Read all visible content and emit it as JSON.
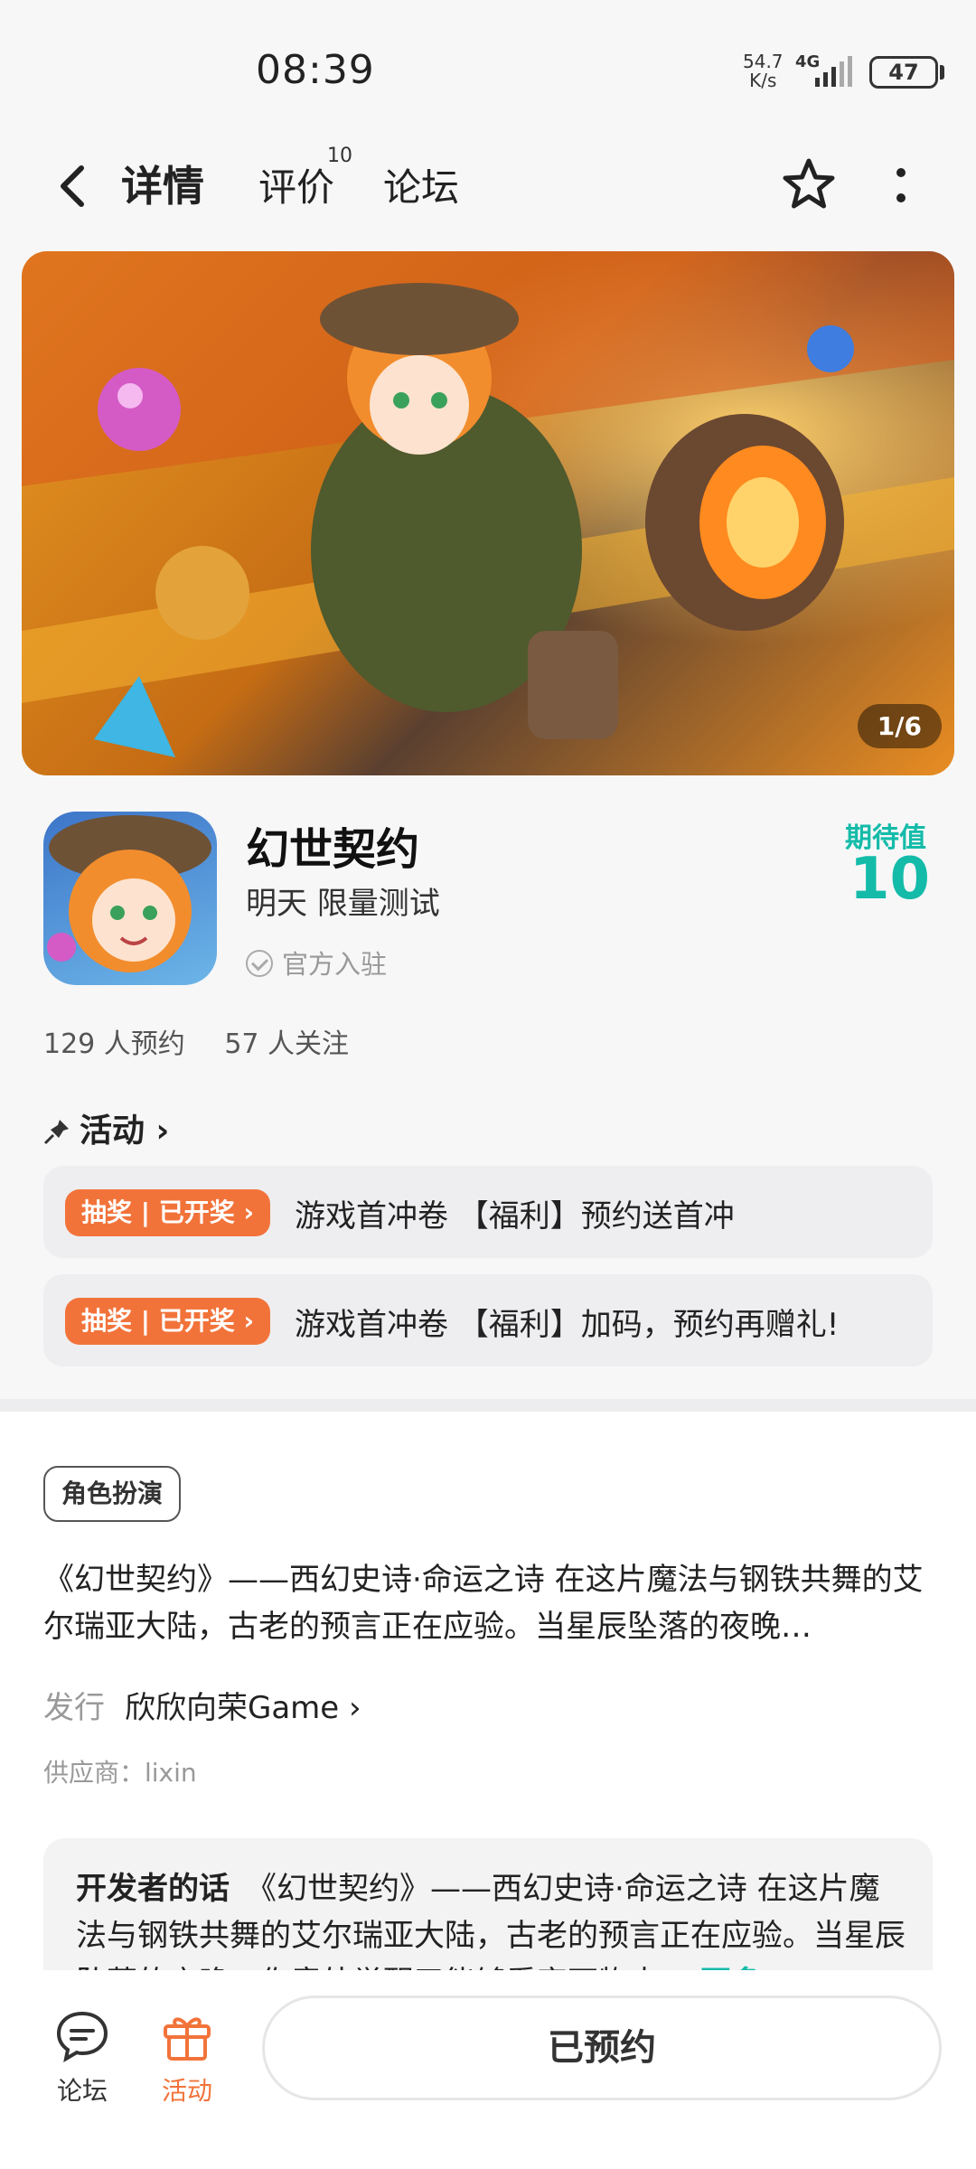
{
  "status_bar": {
    "time": "08:39",
    "net_speed_value": "54.7",
    "net_speed_unit": "K/s",
    "network": "4G",
    "battery": "47"
  },
  "header": {
    "tabs": [
      {
        "label": "详情",
        "active": true
      },
      {
        "label": "评价",
        "count": "10"
      },
      {
        "label": "论坛"
      }
    ]
  },
  "banner": {
    "counter": "1/6"
  },
  "game": {
    "title": "幻世契约",
    "subtitle": "明天 限量测试",
    "official": "官方入驻",
    "expect_label": "期待值",
    "expect_value": "10"
  },
  "stats": {
    "reservations": "129 人预约",
    "followers": "57 人关注"
  },
  "activities": {
    "heading": "活动",
    "items": [
      {
        "badge": "抽奖 | 已开奖 ›",
        "text": "游戏首冲卷 【福利】预约送首冲"
      },
      {
        "badge": "抽奖 | 已开奖 ›",
        "text": "游戏首冲卷 【福利】加码，预约再赠礼!"
      }
    ]
  },
  "details": {
    "tag": "角色扮演",
    "description": "《幻世契约》——西幻史诗·命运之诗 在这片魔法与钢铁共舞的艾尔瑞亚大陆，古老的预言正在应验。当星辰坠落的夜晚…",
    "publisher_label": "发行",
    "publisher_name": "欣欣向荣Game ›",
    "supplier": "供应商：lixin"
  },
  "developer_note": {
    "label": "开发者的话",
    "text": "《幻世契约》——西幻史诗·命运之诗 在这片魔法与钢铁共舞的艾尔瑞亚大陆，古老的预言正在应验。当星辰坠落的夜晚，你意外觉醒了能够看穿万物本…",
    "more": "更多"
  },
  "bottom_nav": {
    "forum": "论坛",
    "activity": "活动",
    "reserve_button": "已预约"
  },
  "colors": {
    "accent": "#14bba9",
    "badge": "#f2733a"
  }
}
